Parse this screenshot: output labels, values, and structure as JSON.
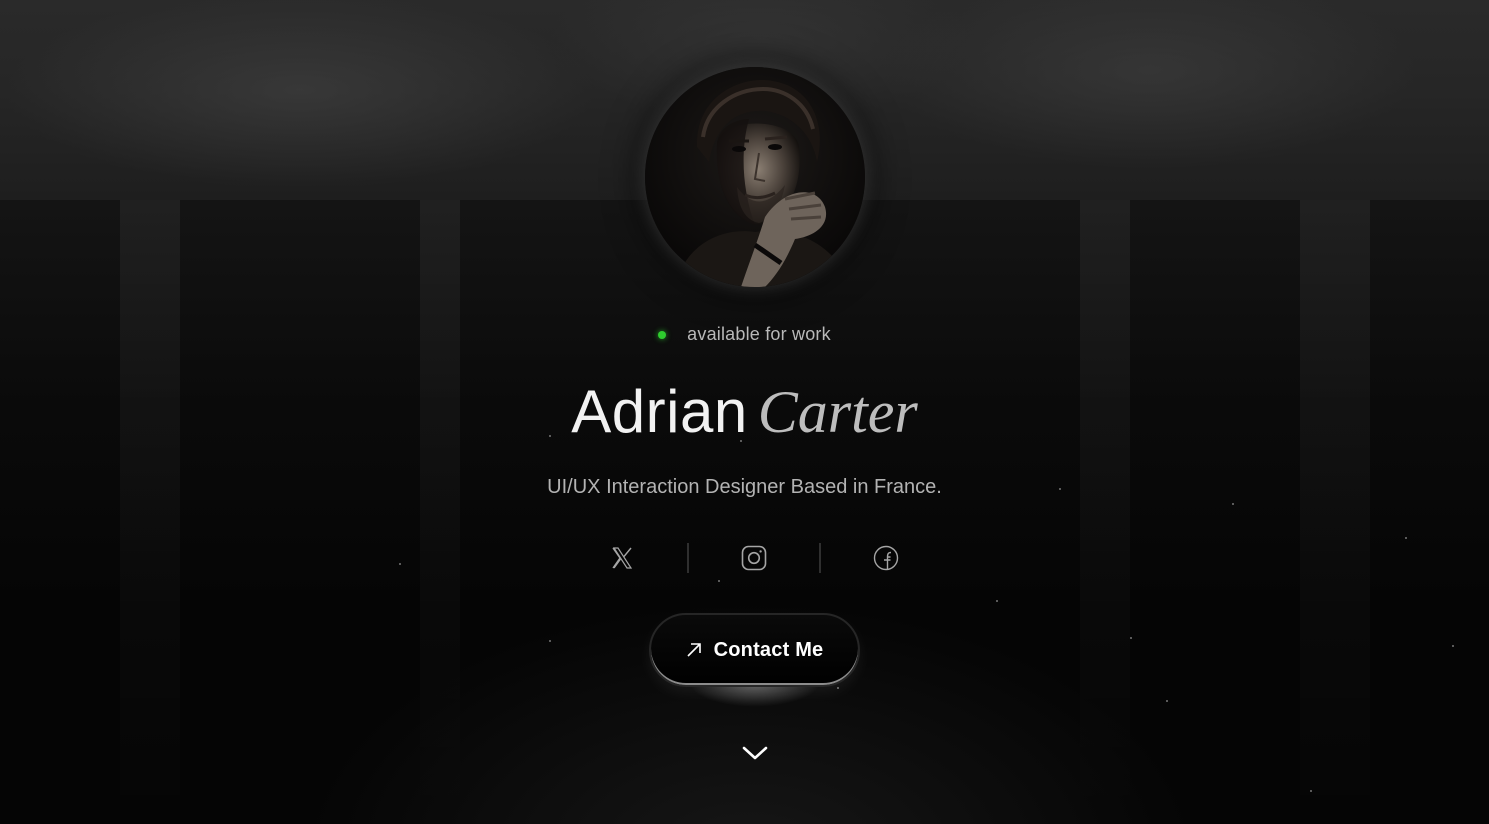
{
  "hero": {
    "status_text": "available for work",
    "status_color": "#2ecc2e",
    "first_name": "Adrian",
    "last_name": "Carter",
    "tagline": "UI/UX Interaction Designer Based in France.",
    "avatar_icon": "portrait-photo"
  },
  "socials": [
    {
      "name": "x",
      "icon": "x-icon"
    },
    {
      "name": "instagram",
      "icon": "instagram-icon"
    },
    {
      "name": "facebook",
      "icon": "facebook-icon"
    }
  ],
  "cta": {
    "label": "Contact Me",
    "icon": "arrow-up-right-icon"
  },
  "scroll": {
    "icon": "chevron-down-icon"
  },
  "colors": {
    "background": "#050505",
    "text_primary": "#f2f2f2",
    "text_secondary": "#b3b3b3"
  }
}
